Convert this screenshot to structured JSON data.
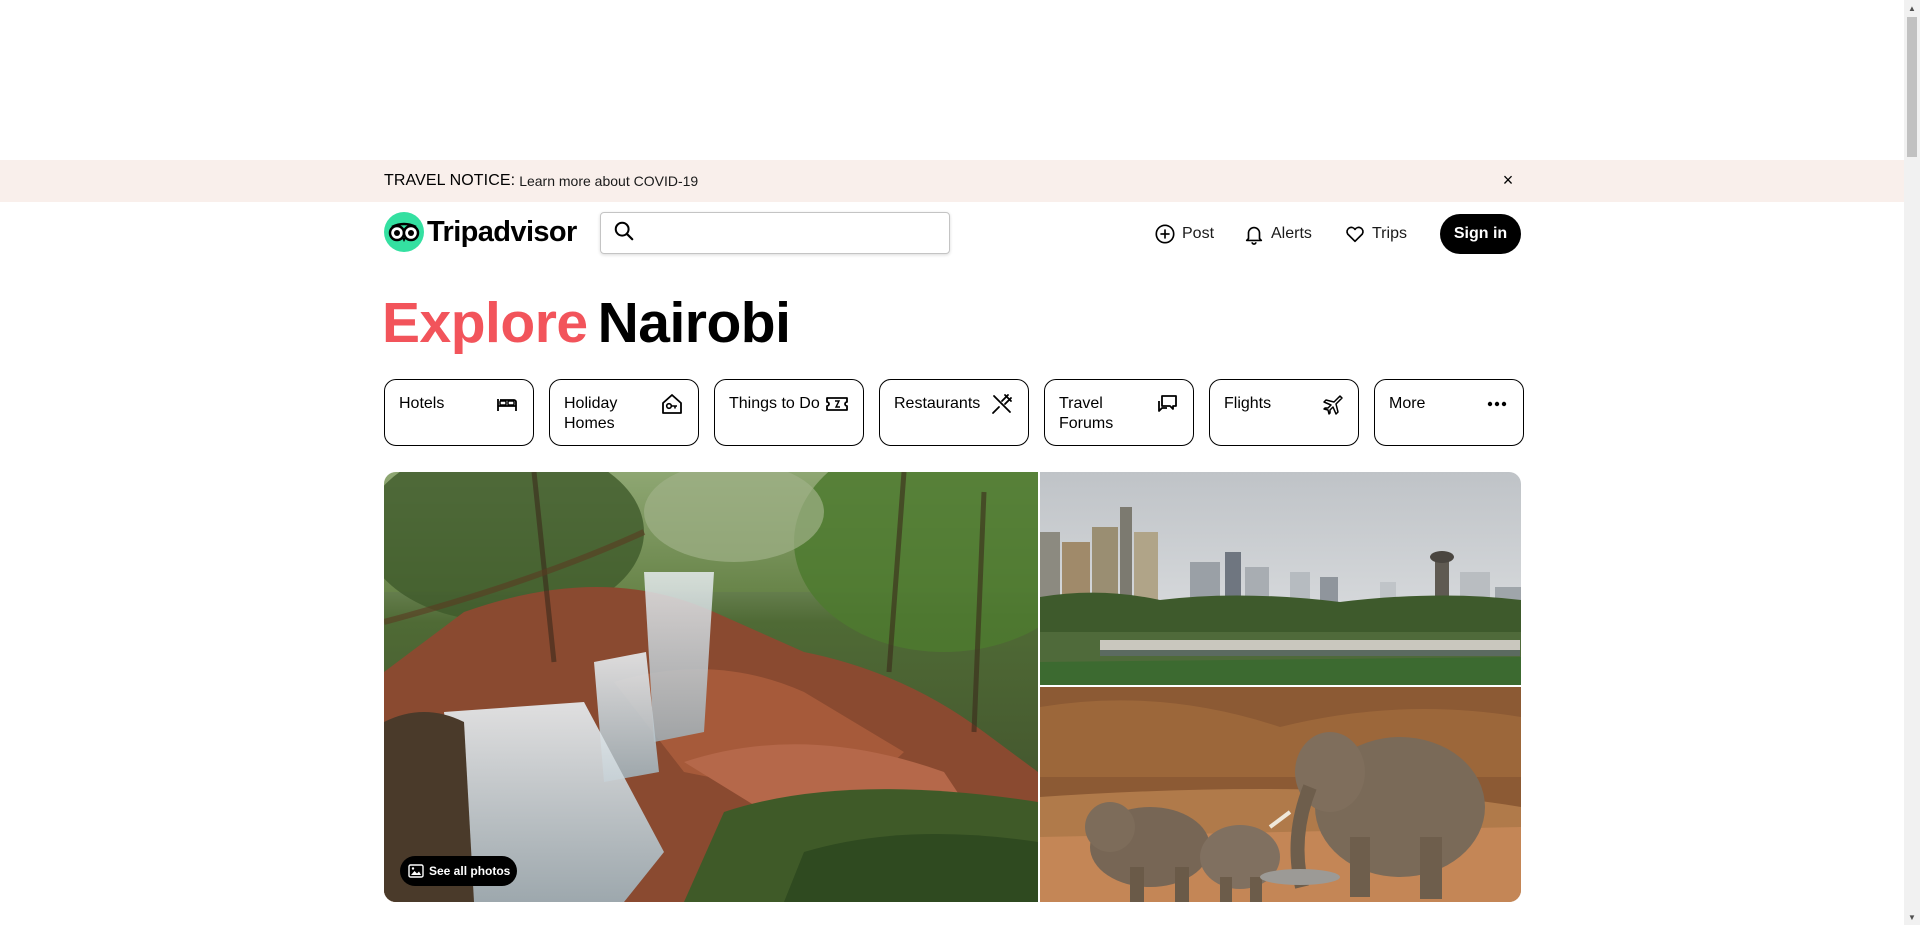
{
  "notice": {
    "label": "TRAVEL NOTICE:",
    "link": "Learn more about COVID-19",
    "close": "×"
  },
  "header": {
    "brand": "Tripadvisor",
    "search_placeholder": "",
    "nav": {
      "post": "Post",
      "alerts": "Alerts",
      "trips": "Trips"
    },
    "signin": "Sign in"
  },
  "title": {
    "accent": "Explore",
    "city": "Nairobi"
  },
  "categories": [
    {
      "label": "Hotels",
      "icon": "bed-icon"
    },
    {
      "label": "Holiday Homes",
      "icon": "house-key-icon"
    },
    {
      "label": "Things to Do",
      "icon": "ticket-icon"
    },
    {
      "label": "Restaurants",
      "icon": "fork-knife-icon"
    },
    {
      "label": "Travel Forums",
      "icon": "chat-bubbles-icon"
    },
    {
      "label": "Flights",
      "icon": "airplane-icon"
    },
    {
      "label": "More",
      "icon": "more-dots-icon"
    }
  ],
  "gallery": {
    "see_all": "See all photos"
  },
  "colors": {
    "brand_green": "#34e0a1",
    "accent_red": "#f2545b",
    "notice_bg": "#f9efeb"
  }
}
